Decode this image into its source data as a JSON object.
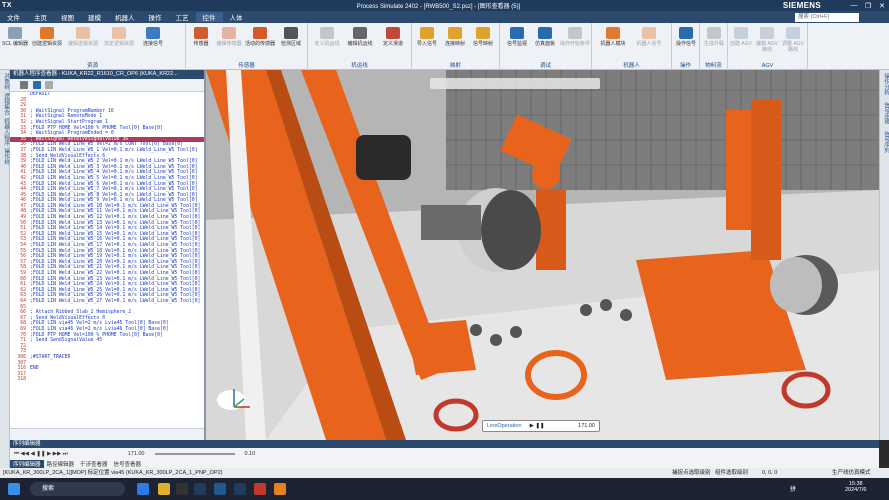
{
  "app": {
    "logo": "TX",
    "title": "Process Simulate 2402 - [RWB500_S2.psz] - [图形查看器 (5)]",
    "brand": "SIEMENS",
    "window_controls": [
      "—",
      "❐",
      "✕"
    ]
  },
  "menu": {
    "items": [
      "文件",
      "主页",
      "视图",
      "建模",
      "机器人",
      "操作",
      "工艺",
      "控件",
      "人体"
    ],
    "active_index": 7,
    "search_placeholder": "搜索 (Ctrl+F)"
  },
  "ribbon": {
    "groups": [
      {
        "label": "资源",
        "buttons": [
          "SCL 编辑器",
          "创建逻辑资源",
          "编辑逻辑资源",
          "加定逻辑资源",
          "连接信号"
        ]
      },
      {
        "label": "传感器",
        "buttons": [
          "传感器",
          "编辑传感器",
          "活动的传感器",
          "检测区域"
        ]
      },
      {
        "label": "机运线",
        "buttons": [
          "定义机运线",
          "编辑机运线",
          "定义滑道"
        ]
      },
      {
        "label": "映射",
        "buttons": [
          "导入信号",
          "连接映射",
          "信号映射"
        ]
      },
      {
        "label": "调试",
        "buttons": [
          "信号监视",
          "仿真面板",
          "操作开始条件"
        ]
      },
      {
        "label": "机器人",
        "buttons": [
          "机器人模块",
          "机器人信号"
        ]
      },
      {
        "label": "操作",
        "buttons": [
          "操作信号"
        ]
      },
      {
        "label": "物料流",
        "buttons": [
          "生成外联"
        ]
      },
      {
        "label": "AGV",
        "buttons": [
          "创建 AGV",
          "编辑 AGV 路线",
          "调整 AGV 路线"
        ]
      }
    ]
  },
  "left_strip": {
    "tabs": [
      "对象树",
      "逻辑集合",
      "机器人程序",
      "操作树"
    ]
  },
  "right_strip": {
    "tabs": [
      "操作分析",
      "信号连接",
      "信号序列"
    ]
  },
  "editor": {
    "header": "机器人程序查看器 - KUKA_KR22_R1610_CR_OP6 (KUKA_KR22...",
    "top_line": "DEFAULT",
    "lines": [
      {
        "n": "28",
        "t": ""
      },
      {
        "n": "29",
        "t": ""
      },
      {
        "n": "30",
        "t": "  ; WaitSignal  ProgramNumber 16"
      },
      {
        "n": "31",
        "t": "  ; WaitSignal  RemoteMode 1"
      },
      {
        "n": "32",
        "t": "  ; WaitSignal  StartProgram 1"
      },
      {
        "n": "33",
        "t": "  ;FOLD PTP HOME Vel=100 % PHOME Tool[0] Base[0]"
      },
      {
        "n": "34",
        "t": "  ; WaitSignal  ProgramEnded = 0"
      },
      {
        "n": "35",
        "t": "  ; WaitSignal  ReceiveSignalValue 36",
        "hl": true
      },
      {
        "n": "36",
        "t": "  ;FOLD LIN Weld_Line_W5 Vel=2 m/s CONT Tool[0] Base[0]"
      },
      {
        "n": "37",
        "t": "  ;FOLD LIN Weld_Line_W5_1 Vel=0.1 m/s LWeld_Line_W5 Tool[0]"
      },
      {
        "n": "38",
        "t": "  ; Send  WeldVisualEffects 6"
      },
      {
        "n": "39",
        "t": "  ;FOLD LIN Weld_Line_W5_2 Vel=0.1 m/s LWeld_Line_W5 Tool[0]"
      },
      {
        "n": "40",
        "t": "  ;FOLD LIN Weld_Line_W5_3 Vel=0.1 m/s LWeld_Line_W5 Tool[0]"
      },
      {
        "n": "41",
        "t": "  ;FOLD LIN Weld_Line_W5_4 Vel=0.1 m/s LWeld_Line_W5 Tool[0]"
      },
      {
        "n": "42",
        "t": "  ;FOLD LIN Weld_Line_W5_5 Vel=0.1 m/s LWeld_Line_W5 Tool[0]"
      },
      {
        "n": "43",
        "t": "  ;FOLD LIN Weld_Line_W5_6 Vel=0.1 m/s LWeld_Line_W5 Tool[0]"
      },
      {
        "n": "44",
        "t": "  ;FOLD LIN Weld_Line_W5_7 Vel=0.1 m/s LWeld_Line_W5 Tool[0]"
      },
      {
        "n": "45",
        "t": "  ;FOLD LIN Weld_Line_W5_8 Vel=0.1 m/s LWeld_Line_W5 Tool[0]"
      },
      {
        "n": "46",
        "t": "  ;FOLD LIN Weld_Line_W5_9 Vel=0.1 m/s LWeld_Line_W5 Tool[0]"
      },
      {
        "n": "47",
        "t": "  ;FOLD LIN Weld_Line_W5_10 Vel=0.1 m/s LWeld_Line_W5 Tool[0]"
      },
      {
        "n": "48",
        "t": "  ;FOLD LIN Weld_Line_W5_11 Vel=0.1 m/s LWeld_Line_W5 Tool[0]"
      },
      {
        "n": "49",
        "t": "  ;FOLD LIN Weld_Line_W5_12 Vel=0.1 m/s LWeld_Line_W5 Tool[0]"
      },
      {
        "n": "50",
        "t": "  ;FOLD LIN Weld_Line_W5_13 Vel=0.1 m/s LWeld_Line_W5 Tool[0]"
      },
      {
        "n": "51",
        "t": "  ;FOLD LIN Weld_Line_W5_14 Vel=0.1 m/s LWeld_Line_W5 Tool[0]"
      },
      {
        "n": "52",
        "t": "  ;FOLD LIN Weld_Line_W5_15 Vel=0.1 m/s LWeld_Line_W5 Tool[0]"
      },
      {
        "n": "53",
        "t": "  ;FOLD LIN Weld_Line_W5_16 Vel=0.1 m/s LWeld_Line_W5 Tool[0]"
      },
      {
        "n": "54",
        "t": "  ;FOLD LIN Weld_Line_W5_17 Vel=0.1 m/s LWeld_Line_W5 Tool[0]"
      },
      {
        "n": "55",
        "t": "  ;FOLD LIN Weld_Line_W5_18 Vel=0.1 m/s LWeld_Line_W5 Tool[0]"
      },
      {
        "n": "56",
        "t": "  ;FOLD LIN Weld_Line_W5_19 Vel=0.1 m/s LWeld_Line_W5 Tool[0]"
      },
      {
        "n": "57",
        "t": "  ;FOLD LIN Weld_Line_W5_20 Vel=0.1 m/s LWeld_Line_W5 Tool[0]"
      },
      {
        "n": "58",
        "t": "  ;FOLD LIN Weld_Line_W5_21 Vel=0.1 m/s LWeld_Line_W5 Tool[0]"
      },
      {
        "n": "59",
        "t": "  ;FOLD LIN Weld_Line_W5_22 Vel=0.1 m/s LWeld_Line_W5 Tool[0]"
      },
      {
        "n": "60",
        "t": "  ;FOLD LIN Weld_Line_W5_23 Vel=0.1 m/s LWeld_Line_W5 Tool[0]"
      },
      {
        "n": "61",
        "t": "  ;FOLD LIN Weld_Line_W5_24 Vel=0.1 m/s LWeld_Line_W5 Tool[0]"
      },
      {
        "n": "62",
        "t": "  ;FOLD LIN Weld_Line_W5_25 Vel=0.1 m/s LWeld_Line_W5 Tool[0]"
      },
      {
        "n": "63",
        "t": "  ;FOLD LIN Weld_Line_W5_26 Vel=0.1 m/s LWeld_Line_W5 Tool[0]"
      },
      {
        "n": "64",
        "t": "  ;FOLD LIN Weld_Line_W5_27 Vel=0.1 m/s LWeld_Line_W5 Tool[0]"
      },
      {
        "n": "65",
        "t": ""
      },
      {
        "n": "66",
        "t": "  ; Attach  Ribbed_Slab_2 Hemisphere_2"
      },
      {
        "n": "67",
        "t": "  ; Send  WeldVisualEffects 0"
      },
      {
        "n": "68",
        "t": "  ;FOLD LIN via45 Vel=2 m/s Lvia45 Tool[0] Base[0]"
      },
      {
        "n": "69",
        "t": "  ;FOLD LIN via46 Vel=2 m/s Lvia46 Tool[0] Base[0]"
      },
      {
        "n": "70",
        "t": "  ;FOLD PTP HOME Vel=100 % PHOME Tool[0] Base[0]"
      },
      {
        "n": "71",
        "t": "  ; Send  SendSignalValue 45"
      },
      {
        "n": "72",
        "t": ""
      },
      {
        "n": "73",
        "t": ""
      },
      {
        "n": "306",
        "t": "  ;#START_TRACER"
      },
      {
        "n": "307",
        "t": ""
      },
      {
        "n": "316",
        "t": "  END"
      },
      {
        "n": "317",
        "t": ""
      },
      {
        "n": "318",
        "t": ""
      }
    ]
  },
  "viewport": {
    "overlay_label": "LineOperation",
    "overlay_time": "171.00"
  },
  "sequence": {
    "header": "序列编辑器",
    "time": "171.00",
    "step": "0.10",
    "tabs": [
      "序列编辑器",
      "路径编辑器",
      "干涉查看器",
      "信号查看器"
    ],
    "active_tab": 0
  },
  "status": {
    "left": "[KUKA_KR_300LP_2CA_1][MOP] 标定位置 via45 (KUKA_KR_300LP_2CA_1_PNP_OP2)",
    "mid1": "捕捉点选取级别",
    "mid2": "组件选取级别",
    "coords": "0, 0, 0",
    "right": "生产线仿真模式"
  },
  "taskbar": {
    "search_placeholder": "搜索",
    "time": "15:38",
    "date": "2024/7/6",
    "lang": "拼"
  },
  "colors": {
    "title_bg": "#1f3a5a",
    "menu_bg": "#2c4a6e",
    "accent_orange": "#e8641c",
    "highlight_line": "#b03a5e"
  }
}
